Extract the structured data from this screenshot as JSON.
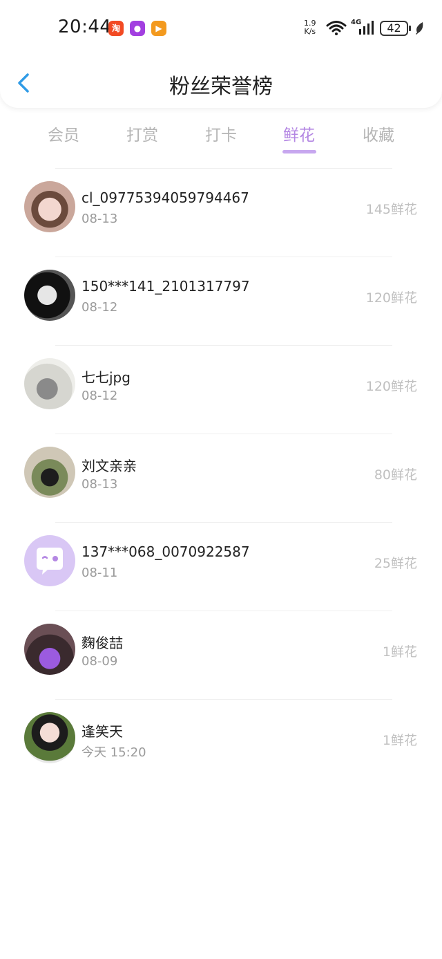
{
  "status_bar": {
    "time": "20:44",
    "apps": [
      "taobao-icon",
      "purple-app-icon",
      "orange-play-icon"
    ],
    "net_speed_value": "1.9",
    "net_speed_unit": "K/s",
    "signal_label": "4G",
    "battery": "42"
  },
  "header": {
    "title": "粉丝荣誉榜"
  },
  "tabs": [
    {
      "label": "会员"
    },
    {
      "label": "打赏"
    },
    {
      "label": "打卡"
    },
    {
      "label": "鲜花",
      "active": true
    },
    {
      "label": "收藏"
    }
  ],
  "colors": {
    "accent": "#b487e3",
    "indicator": "#c7a7ef",
    "muted": "#b5b5b5"
  },
  "fans": [
    {
      "name": "cl_09775394059794467",
      "date": "08-13",
      "score": "145鲜花"
    },
    {
      "name": "150***141_2101317797",
      "date": "08-12",
      "score": "120鲜花"
    },
    {
      "name": "七七jpg",
      "date": "08-12",
      "score": "120鲜花"
    },
    {
      "name": "刘文亲亲",
      "date": "08-13",
      "score": "80鲜花"
    },
    {
      "name": "137***068_0070922587",
      "date": "08-11",
      "score": "25鲜花"
    },
    {
      "name": "麴俊喆",
      "date": "08-09",
      "score": "1鲜花"
    },
    {
      "name": "逢笑天",
      "date": "今天 15:20",
      "score": "1鲜花"
    }
  ]
}
